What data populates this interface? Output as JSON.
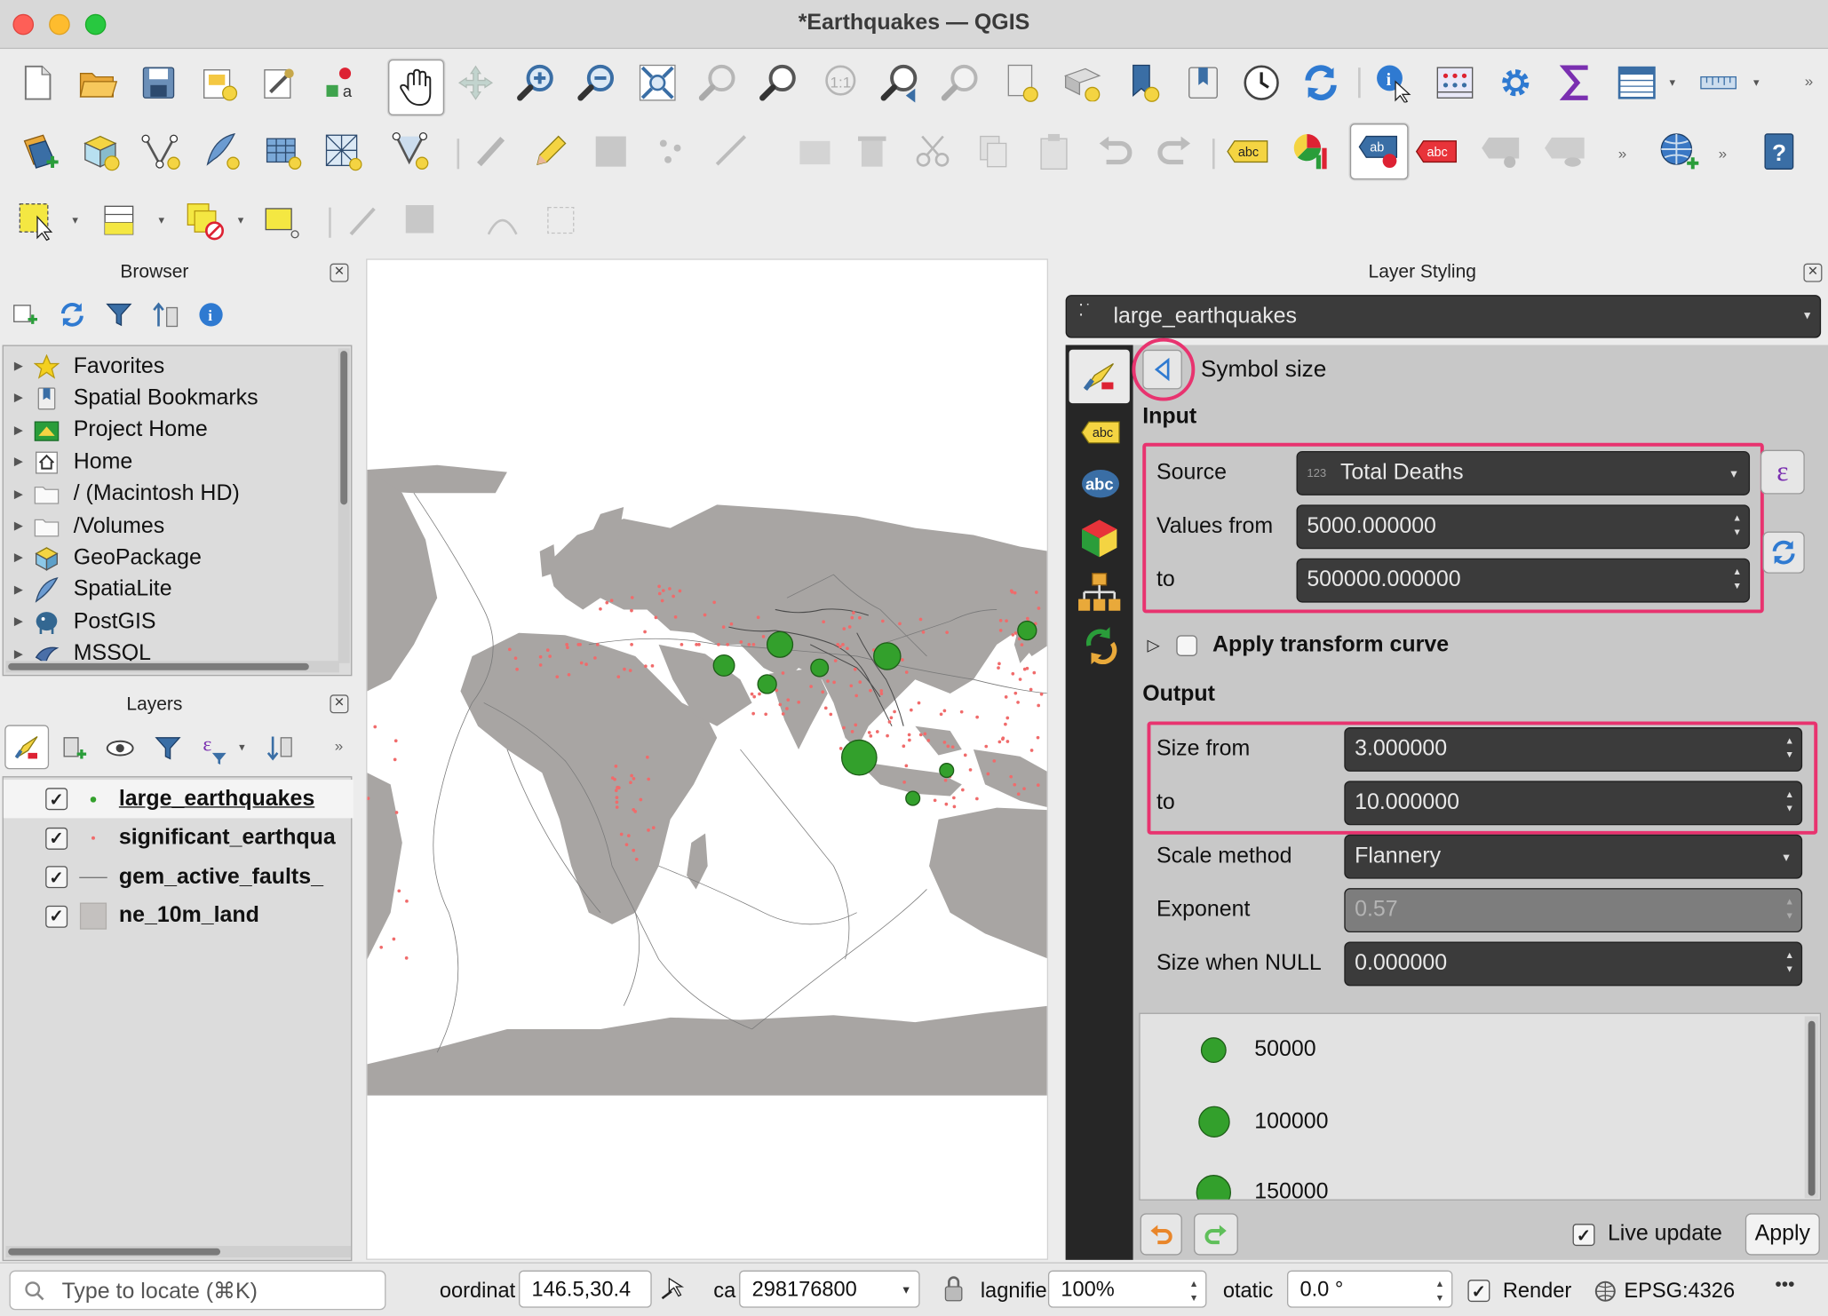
{
  "window": {
    "title": "*Earthquakes — QGIS"
  },
  "browser": {
    "title": "Browser",
    "items": [
      {
        "label": "Favorites",
        "icon": "star-icon"
      },
      {
        "label": "Spatial Bookmarks",
        "icon": "bookmark-icon"
      },
      {
        "label": "Project Home",
        "icon": "project-home-icon"
      },
      {
        "label": "Home",
        "icon": "home-icon"
      },
      {
        "label": "/ (Macintosh HD)",
        "icon": "folder-icon"
      },
      {
        "label": "/Volumes",
        "icon": "folder-icon"
      },
      {
        "label": "GeoPackage",
        "icon": "geopackage-icon"
      },
      {
        "label": "SpatiaLite",
        "icon": "spatialite-icon"
      },
      {
        "label": "PostGIS",
        "icon": "postgis-icon"
      },
      {
        "label": "MSSQL",
        "icon": "mssql-icon"
      }
    ]
  },
  "layers": {
    "title": "Layers",
    "items": [
      {
        "label": "large_earthquakes",
        "checked": true,
        "selected": true
      },
      {
        "label": "significant_earthqua",
        "checked": true,
        "selected": false
      },
      {
        "label": "gem_active_faults_",
        "checked": true,
        "selected": false
      },
      {
        "label": "ne_10m_land",
        "checked": true,
        "selected": false
      }
    ]
  },
  "styling": {
    "title": "Layer Styling",
    "layer_select": "large_earthquakes",
    "heading": "Symbol size",
    "input_section": "Input",
    "source_label": "Source",
    "source_type": "123",
    "source_value": "Total Deaths",
    "values_from_label": "Values from",
    "values_from": "5000.000000",
    "values_to_label": "to",
    "values_to": "500000.000000",
    "transform_curve_label": "Apply transform curve",
    "output_section": "Output",
    "size_from_label": "Size from",
    "size_from": "3.000000",
    "size_to_label": "to",
    "size_to": "10.000000",
    "scale_method_label": "Scale method",
    "scale_method": "Flannery",
    "exponent_label": "Exponent",
    "exponent": "0.57",
    "size_null_label": "Size when NULL",
    "size_null": "0.000000",
    "legend": [
      "50000",
      "100000",
      "150000"
    ],
    "live_update_label": "Live update",
    "live_update": true,
    "apply_label": "Apply"
  },
  "statusbar": {
    "locator_placeholder": "Type to locate (⌘K)",
    "coordinate_label": "oordinat",
    "coordinate": "146.5,30.4",
    "scale_label": "ca",
    "scale": "298176800",
    "magnifier_label": "lagnifie",
    "magnifier": "100%",
    "rotation_label": "otatic",
    "rotation": "0.0 °",
    "render_label": "Render",
    "crs": "EPSG:4326"
  },
  "colors": {
    "highlight": "#e8336f",
    "earthquake_symbol": "#33a02c",
    "land": "#a8a5a3",
    "points": "#f06b6b"
  }
}
